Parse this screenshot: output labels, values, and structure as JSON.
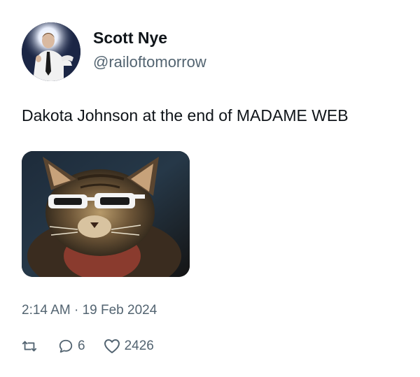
{
  "post": {
    "author": {
      "display_name": "Scott Nye",
      "handle": "@railoftomorrow"
    },
    "text": "Dakota Johnson at the end of MADAME WEB",
    "timestamp": "2:14 AM · 19 Feb 2024",
    "actions": {
      "reply_count": "6",
      "like_count": "2426"
    }
  },
  "icons": {
    "repost": "repost-icon",
    "reply": "reply-icon",
    "like": "heart-icon"
  },
  "colors": {
    "text_primary": "#0f1419",
    "text_secondary": "#536471",
    "background": "#ffffff"
  }
}
